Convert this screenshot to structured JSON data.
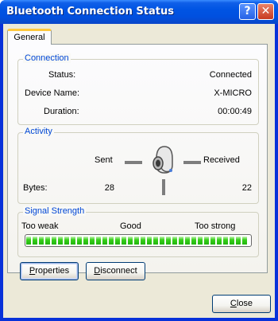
{
  "window": {
    "title": "Bluetooth Connection Status",
    "help_glyph": "?",
    "close_glyph": "✕"
  },
  "tabs": [
    {
      "label": "General",
      "selected": true
    }
  ],
  "connection": {
    "heading": "Connection",
    "status_label": "Status:",
    "status_value": "Connected",
    "device_label": "Device Name:",
    "device_value": "X-MICRO",
    "duration_label": "Duration:",
    "duration_value": "00:00:49"
  },
  "activity": {
    "heading": "Activity",
    "sent_label": "Sent",
    "received_label": "Received",
    "bytes_label": "Bytes:",
    "bytes_sent": "28",
    "bytes_received": "22",
    "icon": "bluetooth-headset-icon"
  },
  "signal": {
    "heading": "Signal Strength",
    "weak_label": "Too weak",
    "good_label": "Good",
    "strong_label": "Too strong",
    "level_percent": 100,
    "segment_count": 35,
    "color": "#2cc414"
  },
  "buttons": {
    "properties_u": "P",
    "properties_rest": "roperties",
    "disconnect_u": "D",
    "disconnect_rest": "isconnect",
    "close_u": "C",
    "close_rest": "lose"
  },
  "colors": {
    "titlebar": "#0054e3",
    "dialog_face": "#ece9d8",
    "group_heading": "#0046d5",
    "tab_highlight": "#ffc83c"
  }
}
